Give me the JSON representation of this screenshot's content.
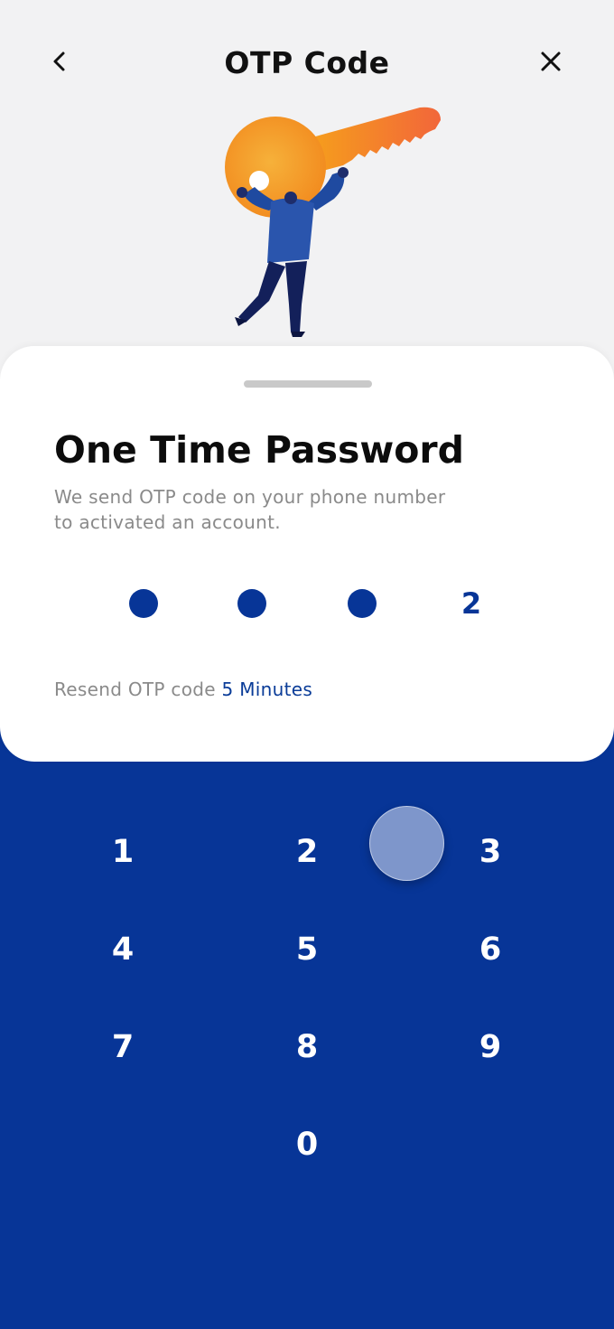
{
  "header": {
    "title": "OTP Code",
    "back_icon": "chevron-left-icon",
    "close_icon": "close-icon"
  },
  "illustration": {
    "name": "person-carrying-key-illustration"
  },
  "sheet": {
    "title": "One Time Password",
    "description_line1": "We send OTP code on your phone number",
    "description_line2": "to activated an account.",
    "otp": {
      "length": 4,
      "entered_digit": "2"
    },
    "resend_label": "Resend OTP code",
    "resend_time": "5 Minutes"
  },
  "keypad": {
    "keys": [
      "1",
      "2",
      "3",
      "4",
      "5",
      "6",
      "7",
      "8",
      "9",
      "0"
    ]
  },
  "colors": {
    "primary": "#073597",
    "accent_key_orange": "#f97a2e",
    "sheet_bg": "#ffffff",
    "page_bg": "#f2f2f3"
  }
}
